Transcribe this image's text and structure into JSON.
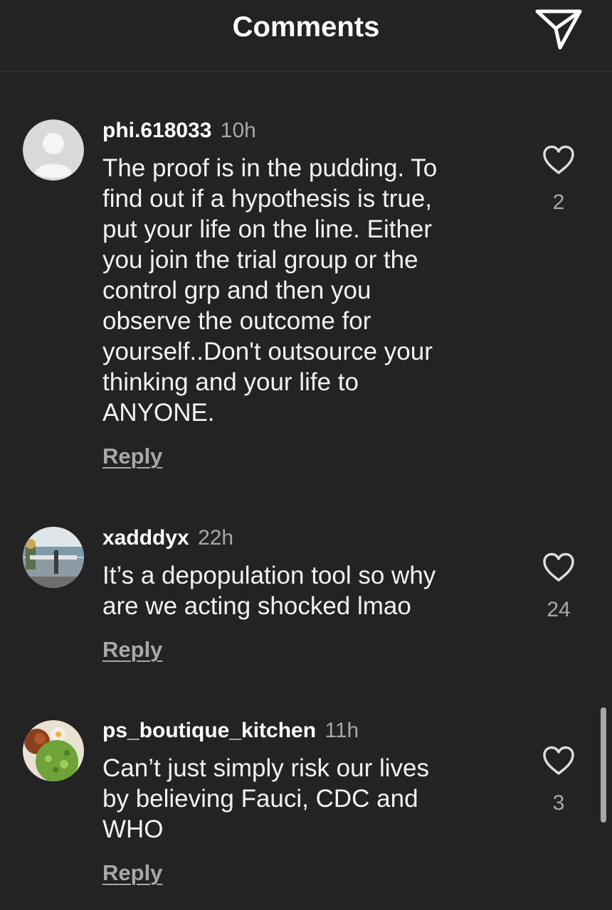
{
  "header": {
    "title": "Comments",
    "share_icon": "paper-plane-icon"
  },
  "comments": [
    {
      "username": "phi.618033",
      "time": "10h",
      "text": "The proof is in the pudding. To\nfind out if a hypothesis is true,\nput your life on the line. Either\nyou join the trial group or the\ncontrol grp and then you\nobserve the outcome for\nyourself..Don't outsource your\nthinking and your life to\nANYONE.",
      "reply_label": "Reply",
      "like_count": "2",
      "avatar": "default-avatar-icon"
    },
    {
      "username": "xadddyx",
      "time": "22h",
      "text": "It’s a depopulation tool so why\nare we acting shocked lmao",
      "reply_label": "Reply",
      "like_count": "24",
      "avatar": "photo-avatar-outdoor"
    },
    {
      "username": "ps_boutique_kitchen",
      "time": "11h",
      "text": "Can’t just simply risk our lives\nby believing Fauci, CDC and\nWHO",
      "reply_label": "Reply",
      "like_count": "3",
      "avatar": "photo-avatar-food"
    }
  ],
  "colors": {
    "background": "#232323",
    "text_primary": "#f2f2f2",
    "text_secondary": "#a8a8a8"
  }
}
